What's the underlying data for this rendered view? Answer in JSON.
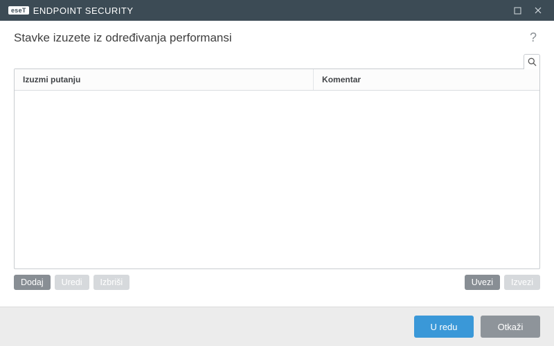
{
  "titlebar": {
    "badge": "eseT",
    "product": "ENDPOINT SECURITY"
  },
  "page": {
    "title": "Stavke izuzete iz određivanja performansi"
  },
  "table": {
    "columns": {
      "path": "Izuzmi putanju",
      "comment": "Komentar"
    },
    "rows": []
  },
  "actions": {
    "add": "Dodaj",
    "edit": "Uredi",
    "delete": "Izbriši",
    "import": "Uvezi",
    "export": "Izvezi"
  },
  "footer": {
    "ok": "U redu",
    "cancel": "Otkaži"
  }
}
